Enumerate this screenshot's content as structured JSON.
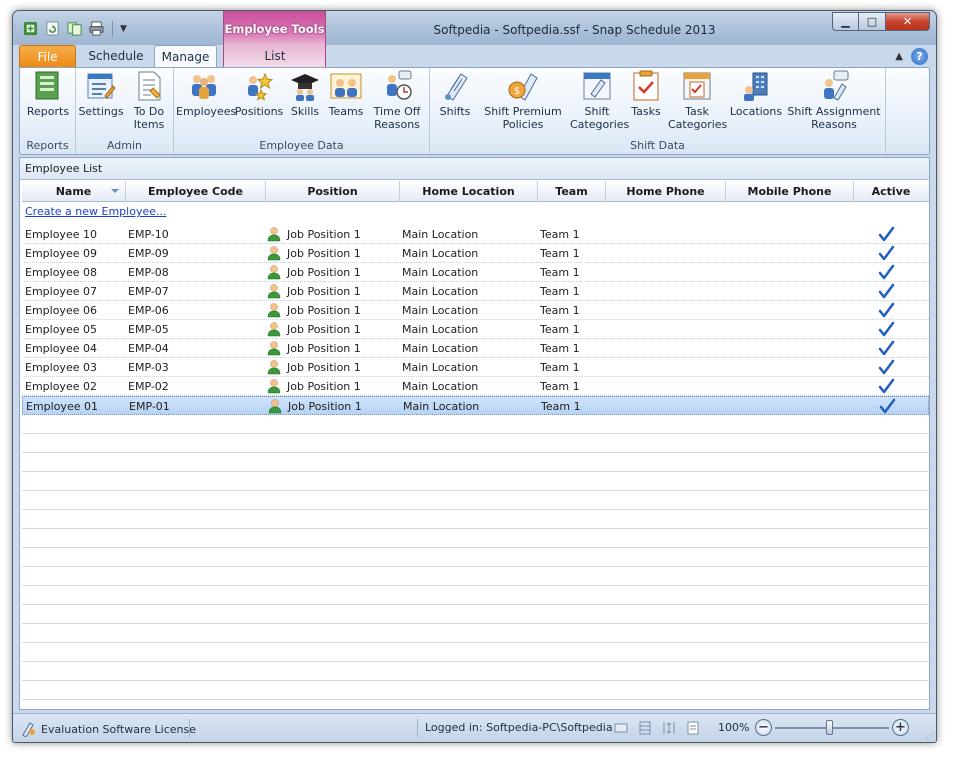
{
  "window": {
    "title": "Softpedia - Softpedia.ssf - Snap Schedule 2013"
  },
  "context_tab": {
    "title": "Employee Tools"
  },
  "tabs": {
    "file": "File",
    "schedule": "Schedule",
    "manage": "Manage",
    "list": "List"
  },
  "ribbon": {
    "groups": [
      {
        "label": "Reports",
        "buttons": [
          "Reports"
        ]
      },
      {
        "label": "Admin",
        "buttons": [
          "Settings",
          "To Do Items"
        ]
      },
      {
        "label": "Employee Data",
        "buttons": [
          "Employees",
          "Positions",
          "Skills",
          "Teams",
          "Time Off Reasons"
        ]
      },
      {
        "label": "Shift Data",
        "buttons": [
          "Shifts",
          "Shift Premium Policies",
          "Shift Categories",
          "Tasks",
          "Task Categories",
          "Locations",
          "Shift Assignment Reasons"
        ]
      }
    ],
    "btn": {
      "reports": "Reports",
      "settings": "Settings",
      "todo_1": "To Do",
      "todo_2": "Items",
      "employees": "Employees",
      "positions": "Positions",
      "skills": "Skills",
      "teams": "Teams",
      "timeoff_1": "Time Off",
      "timeoff_2": "Reasons",
      "shifts": "Shifts",
      "premium_1": "Shift Premium",
      "premium_2": "Policies",
      "shiftcat_1": "Shift",
      "shiftcat_2": "Categories",
      "tasks": "Tasks",
      "taskcat_1": "Task",
      "taskcat_2": "Categories",
      "locations": "Locations",
      "assign_1": "Shift Assignment",
      "assign_2": "Reasons"
    },
    "group_labels": {
      "reports": "Reports",
      "admin": "Admin",
      "employee_data": "Employee Data",
      "shift_data": "Shift Data"
    }
  },
  "panel": {
    "title": "Employee List",
    "create_link": "Create a new Employee..."
  },
  "columns": {
    "name": "Name",
    "code": "Employee Code",
    "position": "Position",
    "home_location": "Home Location",
    "team": "Team",
    "home_phone": "Home Phone",
    "mobile_phone": "Mobile Phone",
    "active": "Active"
  },
  "employees": [
    {
      "name": "Employee 10",
      "code": "EMP-10",
      "position": "Job Position 1",
      "location": "Main Location",
      "team": "Team 1",
      "active": true
    },
    {
      "name": "Employee 09",
      "code": "EMP-09",
      "position": "Job Position 1",
      "location": "Main Location",
      "team": "Team 1",
      "active": true
    },
    {
      "name": "Employee 08",
      "code": "EMP-08",
      "position": "Job Position 1",
      "location": "Main Location",
      "team": "Team 1",
      "active": true
    },
    {
      "name": "Employee 07",
      "code": "EMP-07",
      "position": "Job Position 1",
      "location": "Main Location",
      "team": "Team 1",
      "active": true
    },
    {
      "name": "Employee 06",
      "code": "EMP-06",
      "position": "Job Position 1",
      "location": "Main Location",
      "team": "Team 1",
      "active": true
    },
    {
      "name": "Employee 05",
      "code": "EMP-05",
      "position": "Job Position 1",
      "location": "Main Location",
      "team": "Team 1",
      "active": true
    },
    {
      "name": "Employee 04",
      "code": "EMP-04",
      "position": "Job Position 1",
      "location": "Main Location",
      "team": "Team 1",
      "active": true
    },
    {
      "name": "Employee 03",
      "code": "EMP-03",
      "position": "Job Position 1",
      "location": "Main Location",
      "team": "Team 1",
      "active": true
    },
    {
      "name": "Employee 02",
      "code": "EMP-02",
      "position": "Job Position 1",
      "location": "Main Location",
      "team": "Team 1",
      "active": true
    },
    {
      "name": "Employee 01",
      "code": "EMP-01",
      "position": "Job Position 1",
      "location": "Main Location",
      "team": "Team 1",
      "active": true,
      "selected": true
    }
  ],
  "status": {
    "license": "Evaluation Software License",
    "logged_in": "Logged in: Softpedia-PC\\Softpedia",
    "zoom": "100%",
    "zoom_level_percent": 100
  },
  "colors": {
    "file_tab": "#ec8a17",
    "context_tab": "#c94e9a",
    "accent": "#2d6cc4",
    "selection": "#b7d3f5"
  }
}
